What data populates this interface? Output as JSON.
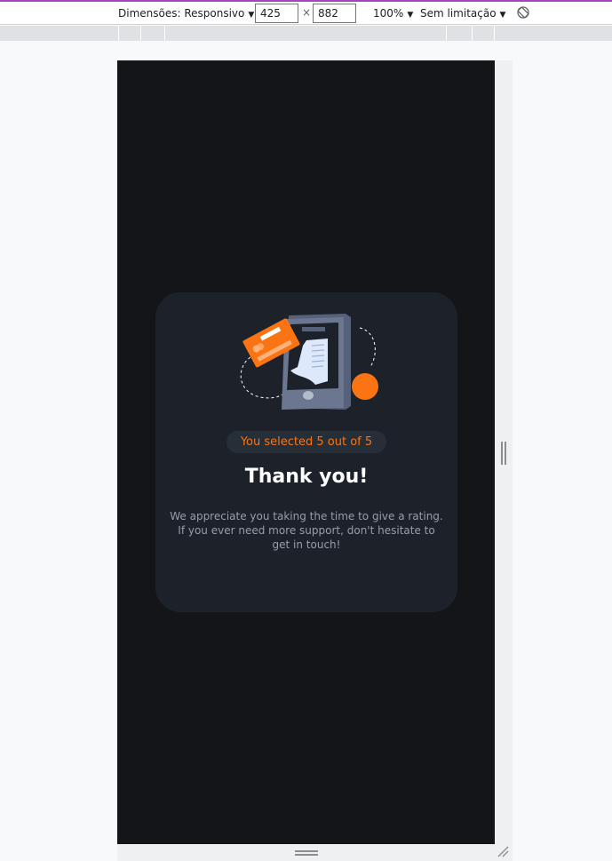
{
  "toolbar": {
    "dimensions_label": "Dimensões: Responsivo",
    "width_value": "425",
    "times_symbol": "×",
    "height_value": "882",
    "zoom_label": "100%",
    "throttle_label": "Sem limitação"
  },
  "card": {
    "selected_text": "You selected 5 out of 5",
    "title": "Thank you!",
    "description": "We appreciate you taking the time to give a rating. If you ever need more support, don't hesitate to get in touch!"
  },
  "colors": {
    "accent_orange": "#fb7413",
    "card_bg": "#1d222a",
    "page_bg": "#131518"
  },
  "icons": [
    "caret-down-icon",
    "rotate-icon",
    "payment-illustration",
    "resize-corner-icon"
  ]
}
